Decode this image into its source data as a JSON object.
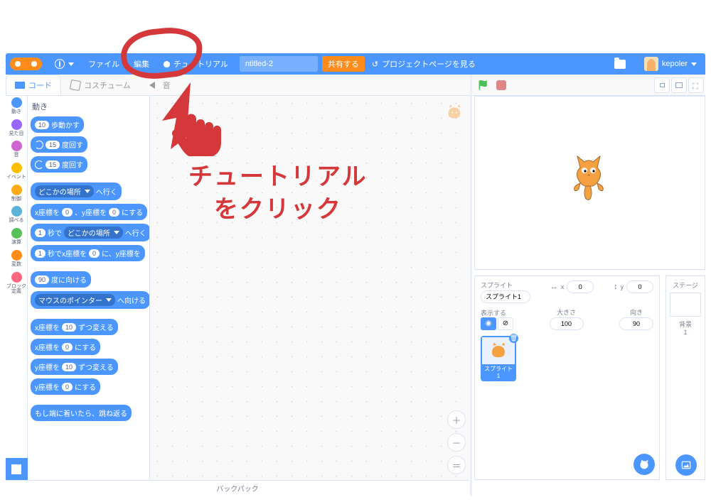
{
  "menubar": {
    "file": "ファイル",
    "edit": "編集",
    "tutorials": "チュートリアル",
    "project_title": "ntitled-2",
    "share": "共有する",
    "project_page": "プロジェクトページを見る",
    "username": "kepoler"
  },
  "tabs": {
    "code": "コード",
    "costumes": "コスチューム",
    "sounds": "音"
  },
  "categories": [
    {
      "label": "動き",
      "color": "#4c97ff"
    },
    {
      "label": "見た目",
      "color": "#9966ff"
    },
    {
      "label": "音",
      "color": "#cf63cf"
    },
    {
      "label": "イベント",
      "color": "#ffbf00"
    },
    {
      "label": "制御",
      "color": "#ffab19"
    },
    {
      "label": "調べる",
      "color": "#5cb1d6"
    },
    {
      "label": "演算",
      "color": "#59c059"
    },
    {
      "label": "変数",
      "color": "#ff8c1a"
    },
    {
      "label": "ブロック定義",
      "color": "#ff6680"
    }
  ],
  "palette_title": "動き",
  "blocks": {
    "move_steps_v": "10",
    "move_steps": "歩動かす",
    "turn_cw_v": "15",
    "turn_cw": "度回す",
    "turn_ccw_v": "15",
    "turn_ccw": "度回す",
    "goto_menu": "どこかの場所",
    "goto_suffix": "へ行く",
    "goto_xy_a": "x座標を",
    "goto_xy_x": "0",
    "goto_xy_b": "、y座標を",
    "goto_xy_y": "0",
    "goto_xy_c": "にする",
    "glide_sec": "1",
    "glide_a": "秒で",
    "glide_menu": "どこかの場所",
    "glide_b": "へ行く",
    "glide_xy_sec": "1",
    "glide_xy_a": "秒でx座標を",
    "glide_xy_x": "0",
    "glide_xy_b": "に、y座標を",
    "point_dir_v": "90",
    "point_dir": "度に向ける",
    "point_to_menu": "マウスのポインター",
    "point_to": "へ向ける",
    "change_x_a": "x座標を",
    "change_x_v": "10",
    "change_x_b": "ずつ変える",
    "set_x_a": "x座標を",
    "set_x_v": "0",
    "set_x_b": "にする",
    "change_y_a": "y座標を",
    "change_y_v": "10",
    "change_y_b": "ずつ変える",
    "set_y_a": "y座標を",
    "set_y_v": "0",
    "set_y_b": "にする",
    "bounce": "もし端に着いたら、跳ね返る"
  },
  "backpack": "バックパック",
  "sprite_panel": {
    "title": "スプライト",
    "name_value": "スプライト1",
    "x_label": "x",
    "x_value": "0",
    "y_label": "y",
    "y_value": "0",
    "show_label": "表示する",
    "size_label": "大きさ",
    "size_value": "100",
    "direction_label": "向き",
    "direction_value": "90",
    "tile_caption": "スプライト1"
  },
  "stage_panel": {
    "title": "ステージ",
    "backdrops_label": "背景",
    "backdrops_count": "1"
  },
  "annotation": {
    "line1": "チュートリアル",
    "line2": "をクリック"
  }
}
